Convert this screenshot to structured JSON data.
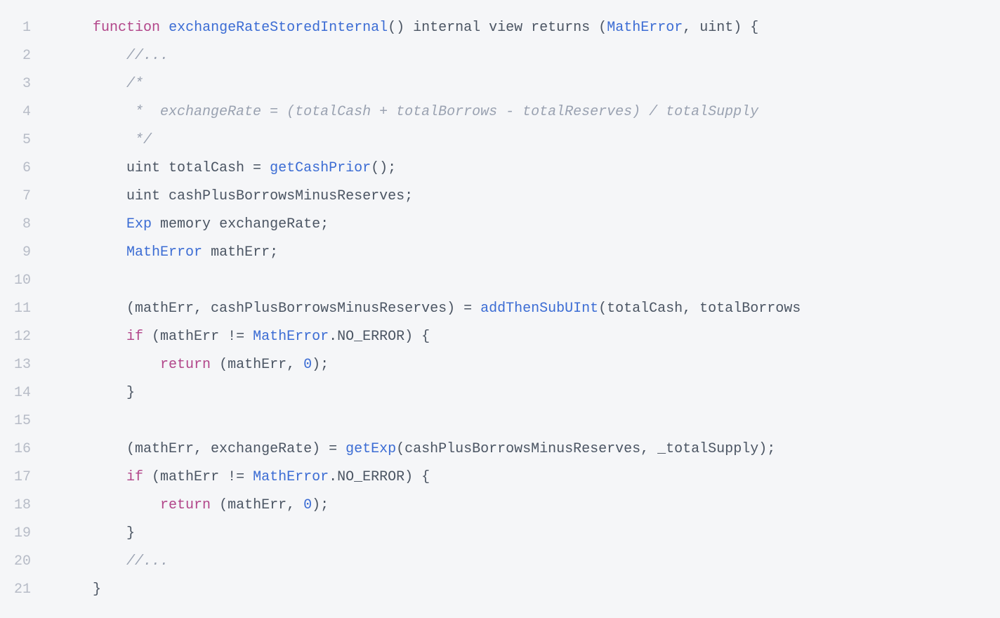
{
  "lines": [
    {
      "n": "1",
      "indent": 4,
      "tokens": [
        [
          "kw",
          "function"
        ],
        [
          "txt",
          " "
        ],
        [
          "fn",
          "exchangeRateStoredInternal"
        ],
        [
          "txt",
          "() internal view returns ("
        ],
        [
          "fn",
          "MathError"
        ],
        [
          "txt",
          ", uint) {"
        ]
      ]
    },
    {
      "n": "2",
      "indent": 8,
      "tokens": [
        [
          "com",
          "//..."
        ]
      ]
    },
    {
      "n": "3",
      "indent": 8,
      "tokens": [
        [
          "com",
          "/*"
        ]
      ]
    },
    {
      "n": "4",
      "indent": 8,
      "tokens": [
        [
          "com",
          " *  exchangeRate = (totalCash + totalBorrows - totalReserves) / totalSupply"
        ]
      ]
    },
    {
      "n": "5",
      "indent": 8,
      "tokens": [
        [
          "com",
          " */"
        ]
      ]
    },
    {
      "n": "6",
      "indent": 8,
      "tokens": [
        [
          "txt",
          "uint totalCash = "
        ],
        [
          "fn",
          "getCashPrior"
        ],
        [
          "txt",
          "();"
        ]
      ]
    },
    {
      "n": "7",
      "indent": 8,
      "tokens": [
        [
          "txt",
          "uint cashPlusBorrowsMinusReserves;"
        ]
      ]
    },
    {
      "n": "8",
      "indent": 8,
      "tokens": [
        [
          "fn",
          "Exp"
        ],
        [
          "txt",
          " memory exchangeRate;"
        ]
      ]
    },
    {
      "n": "9",
      "indent": 8,
      "tokens": [
        [
          "fn",
          "MathError"
        ],
        [
          "txt",
          " mathErr;"
        ]
      ]
    },
    {
      "n": "10",
      "indent": 0,
      "tokens": []
    },
    {
      "n": "11",
      "indent": 8,
      "tokens": [
        [
          "txt",
          "(mathErr, cashPlusBorrowsMinusReserves) = "
        ],
        [
          "fn",
          "addThenSubUInt"
        ],
        [
          "txt",
          "(totalCash, totalBorrows"
        ]
      ]
    },
    {
      "n": "12",
      "indent": 8,
      "tokens": [
        [
          "kw",
          "if"
        ],
        [
          "txt",
          " (mathErr != "
        ],
        [
          "fn",
          "MathError"
        ],
        [
          "txt",
          ".NO_ERROR) {"
        ]
      ]
    },
    {
      "n": "13",
      "indent": 12,
      "tokens": [
        [
          "kw",
          "return"
        ],
        [
          "txt",
          " (mathErr, "
        ],
        [
          "num",
          "0"
        ],
        [
          "txt",
          ");"
        ]
      ]
    },
    {
      "n": "14",
      "indent": 8,
      "tokens": [
        [
          "txt",
          "}"
        ]
      ]
    },
    {
      "n": "15",
      "indent": 0,
      "tokens": []
    },
    {
      "n": "16",
      "indent": 8,
      "tokens": [
        [
          "txt",
          "(mathErr, exchangeRate) = "
        ],
        [
          "fn",
          "getExp"
        ],
        [
          "txt",
          "(cashPlusBorrowsMinusReserves, _totalSupply);"
        ]
      ]
    },
    {
      "n": "17",
      "indent": 8,
      "tokens": [
        [
          "kw",
          "if"
        ],
        [
          "txt",
          " (mathErr != "
        ],
        [
          "fn",
          "MathError"
        ],
        [
          "txt",
          ".NO_ERROR) {"
        ]
      ]
    },
    {
      "n": "18",
      "indent": 12,
      "tokens": [
        [
          "kw",
          "return"
        ],
        [
          "txt",
          " (mathErr, "
        ],
        [
          "num",
          "0"
        ],
        [
          "txt",
          ");"
        ]
      ]
    },
    {
      "n": "19",
      "indent": 8,
      "tokens": [
        [
          "txt",
          "}"
        ]
      ]
    },
    {
      "n": "20",
      "indent": 8,
      "tokens": [
        [
          "com",
          "//..."
        ]
      ]
    },
    {
      "n": "21",
      "indent": 4,
      "tokens": [
        [
          "txt",
          "}"
        ]
      ]
    }
  ]
}
